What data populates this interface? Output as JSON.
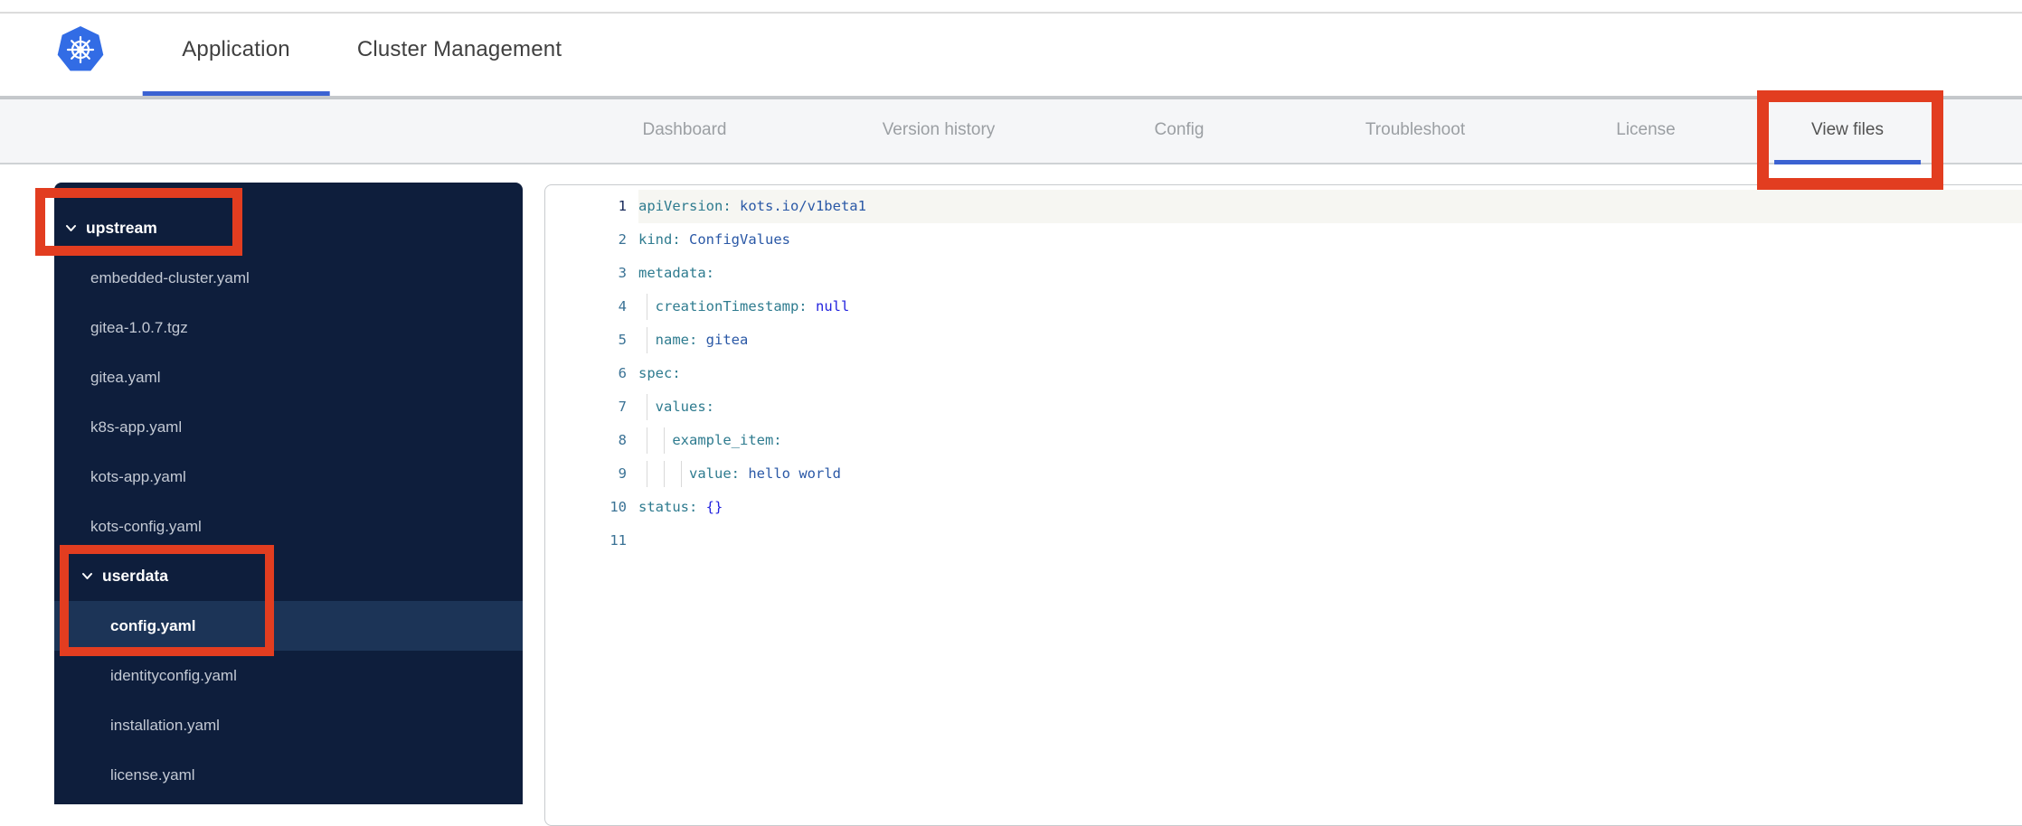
{
  "topbar": {
    "logo": "kubernetes-logo",
    "tabs": [
      {
        "label": "Application",
        "active": true
      },
      {
        "label": "Cluster Management",
        "active": false
      }
    ]
  },
  "subnav": {
    "tabs": [
      {
        "label": "Dashboard",
        "active": false
      },
      {
        "label": "Version history",
        "active": false
      },
      {
        "label": "Config",
        "active": false
      },
      {
        "label": "Troubleshoot",
        "active": false
      },
      {
        "label": "License",
        "active": false
      },
      {
        "label": "View files",
        "active": true
      }
    ]
  },
  "file_tree": {
    "items": [
      {
        "label": "upstream",
        "type": "folder",
        "level": 0,
        "expanded": true,
        "selected": false
      },
      {
        "label": "embedded-cluster.yaml",
        "type": "file",
        "level": 1,
        "selected": false
      },
      {
        "label": "gitea-1.0.7.tgz",
        "type": "file",
        "level": 1,
        "selected": false
      },
      {
        "label": "gitea.yaml",
        "type": "file",
        "level": 1,
        "selected": false
      },
      {
        "label": "k8s-app.yaml",
        "type": "file",
        "level": 1,
        "selected": false
      },
      {
        "label": "kots-app.yaml",
        "type": "file",
        "level": 1,
        "selected": false
      },
      {
        "label": "kots-config.yaml",
        "type": "file",
        "level": 1,
        "selected": false
      },
      {
        "label": "userdata",
        "type": "folder",
        "level": 1,
        "expanded": true,
        "selected": false
      },
      {
        "label": "config.yaml",
        "type": "file",
        "level": 2,
        "selected": true
      },
      {
        "label": "identityconfig.yaml",
        "type": "file",
        "level": 2,
        "selected": false
      },
      {
        "label": "installation.yaml",
        "type": "file",
        "level": 2,
        "selected": false
      },
      {
        "label": "license.yaml",
        "type": "file",
        "level": 2,
        "selected": false
      }
    ]
  },
  "editor": {
    "lines": [
      {
        "num": "1",
        "active": true,
        "guides": [],
        "segments": [
          {
            "t": "key",
            "text": "apiVersion:"
          },
          {
            "t": "val",
            "text": " kots.io/v1beta1"
          }
        ]
      },
      {
        "num": "2",
        "active": false,
        "guides": [],
        "segments": [
          {
            "t": "key",
            "text": "kind:"
          },
          {
            "t": "val",
            "text": " ConfigValues"
          }
        ]
      },
      {
        "num": "3",
        "active": false,
        "guides": [],
        "segments": [
          {
            "t": "key",
            "text": "metadata:"
          }
        ]
      },
      {
        "num": "4",
        "active": false,
        "guides": [
          1
        ],
        "segments": [
          {
            "t": "plain",
            "text": "  "
          },
          {
            "t": "key",
            "text": "creationTimestamp:"
          },
          {
            "t": "atom",
            "text": " null"
          }
        ]
      },
      {
        "num": "5",
        "active": false,
        "guides": [
          1
        ],
        "segments": [
          {
            "t": "plain",
            "text": "  "
          },
          {
            "t": "key",
            "text": "name:"
          },
          {
            "t": "val",
            "text": " gitea"
          }
        ]
      },
      {
        "num": "6",
        "active": false,
        "guides": [],
        "segments": [
          {
            "t": "key",
            "text": "spec:"
          }
        ]
      },
      {
        "num": "7",
        "active": false,
        "guides": [
          1
        ],
        "segments": [
          {
            "t": "plain",
            "text": "  "
          },
          {
            "t": "key",
            "text": "values:"
          }
        ]
      },
      {
        "num": "8",
        "active": false,
        "guides": [
          1,
          3
        ],
        "segments": [
          {
            "t": "plain",
            "text": "    "
          },
          {
            "t": "key",
            "text": "example_item:"
          }
        ]
      },
      {
        "num": "9",
        "active": false,
        "guides": [
          1,
          3,
          5
        ],
        "segments": [
          {
            "t": "plain",
            "text": "      "
          },
          {
            "t": "key",
            "text": "value:"
          },
          {
            "t": "val",
            "text": " hello world"
          }
        ]
      },
      {
        "num": "10",
        "active": false,
        "guides": [],
        "segments": [
          {
            "t": "key",
            "text": "status:"
          },
          {
            "t": "atom",
            "text": " {}"
          }
        ]
      },
      {
        "num": "11",
        "active": false,
        "guides": [],
        "segments": []
      }
    ]
  },
  "annotations": {
    "boxes": [
      "upstream-highlight",
      "userdata-config-highlight",
      "view-files-highlight"
    ],
    "color": "#e23d20"
  },
  "colors": {
    "accent_blue": "#3b62d2",
    "kubernetes_blue": "#326ce5",
    "sidebar_bg": "#0e1e3c",
    "sidebar_selected_bg": "#1c3457",
    "subnav_bg": "#f5f6f8",
    "yaml_key": "#2e7b8f",
    "yaml_value": "#2a58a6",
    "yaml_atom": "#2323de",
    "annotation_red": "#e23d20"
  }
}
